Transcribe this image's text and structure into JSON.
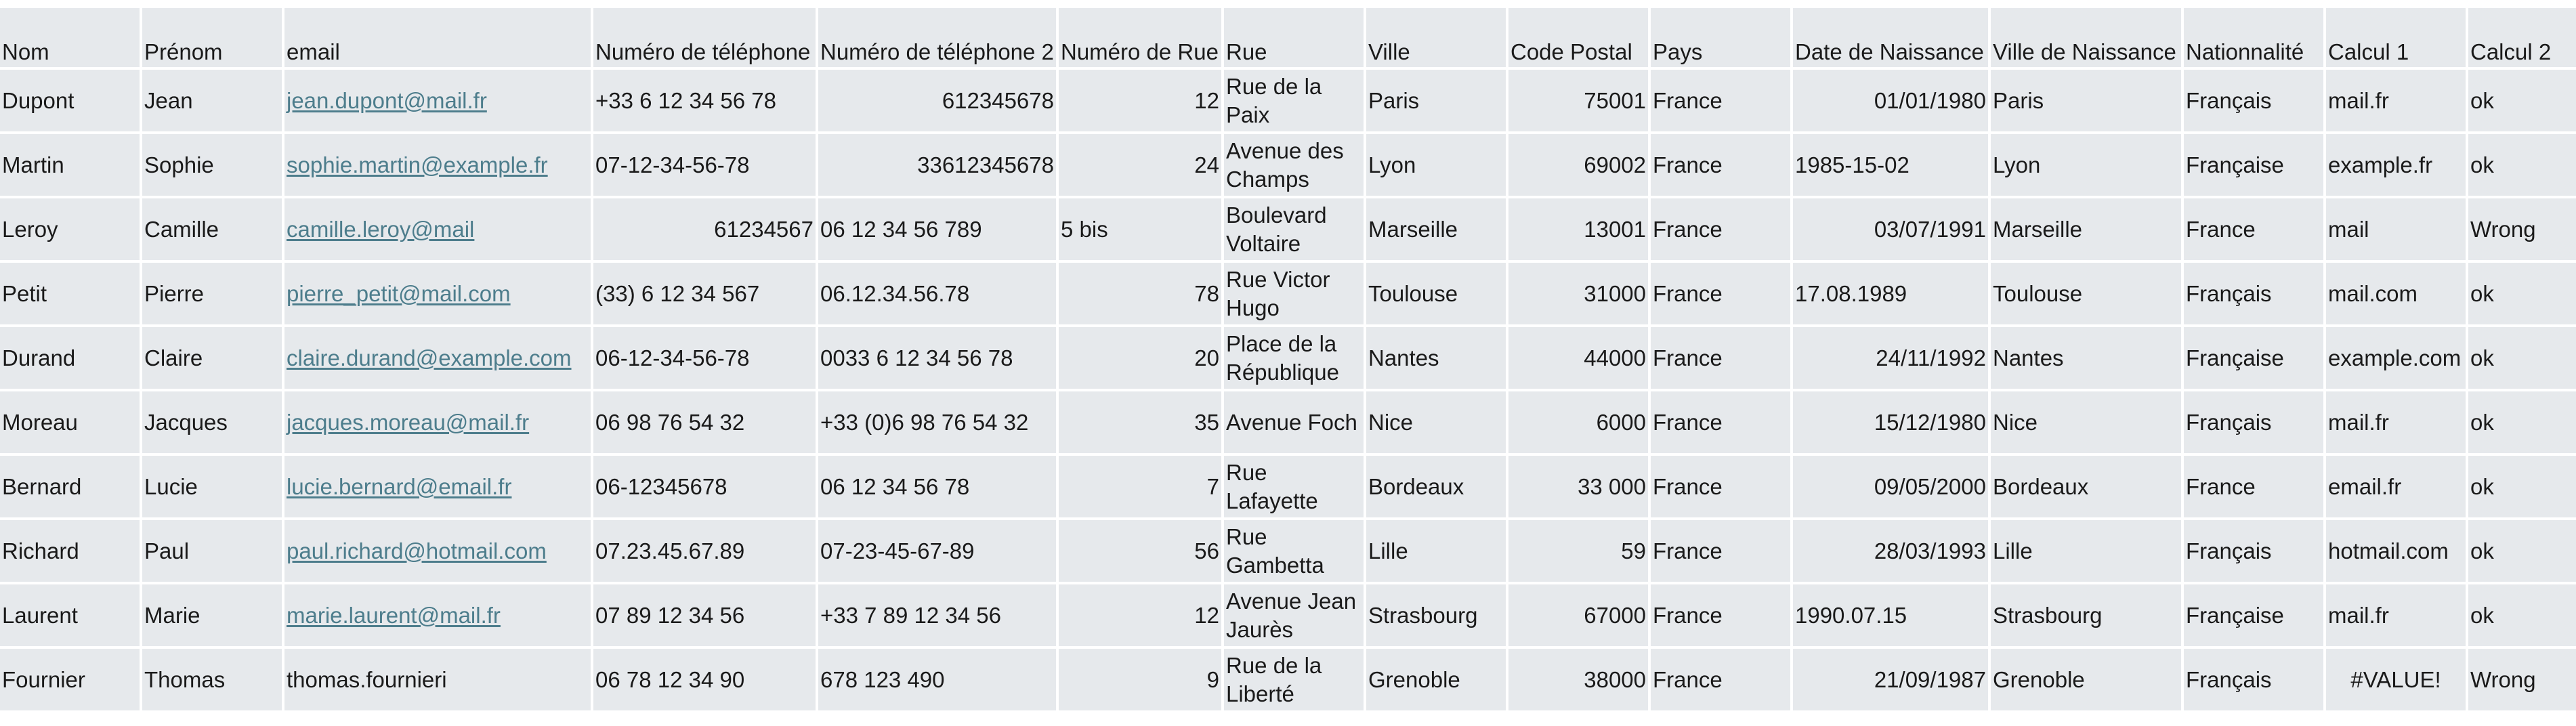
{
  "sheet": {
    "headers": [
      "Nom",
      "Prénom",
      "email",
      "Numéro de téléphone",
      "Numéro de téléphone 2",
      "Numéro de Rue",
      "Rue",
      "Ville",
      "Code Postal",
      "Pays",
      "Date de Naissance",
      "Ville de Naissance",
      "Nationnalité",
      "Calcul 1",
      "Calcul 2"
    ],
    "rows": [
      [
        "Dupont",
        "Jean",
        "jean.dupont@mail.fr",
        "+33 6 12 34 56 78",
        "612345678",
        "12",
        "Rue de la Paix",
        "Paris",
        "75001",
        "France",
        "01/01/1980",
        "Paris",
        "Français",
        "mail.fr",
        "ok"
      ],
      [
        "Martin",
        "Sophie",
        "sophie.martin@example.fr",
        "07-12-34-56-78",
        "33612345678",
        "24",
        "Avenue des Champs",
        "Lyon",
        "69002",
        "France",
        "1985-15-02",
        "Lyon",
        "Française",
        "example.fr",
        "ok"
      ],
      [
        "Leroy",
        "Camille",
        "camille.leroy@mail",
        "61234567",
        "06 12 34 56 789",
        "5 bis",
        "Boulevard Voltaire",
        "Marseille",
        "13001",
        "France",
        "03/07/1991",
        "Marseille",
        "France",
        "mail",
        "Wrong"
      ],
      [
        "Petit",
        "Pierre",
        "pierre_petit@mail.com",
        "(33) 6 12 34 567",
        "06.12.34.56.78",
        "78",
        "Rue Victor Hugo",
        "Toulouse",
        "31000",
        "France",
        "17.08.1989",
        "Toulouse",
        "Français",
        "mail.com",
        "ok"
      ],
      [
        "Durand",
        "Claire",
        "claire.durand@example.com",
        "06-12-34-56-78",
        "0033 6 12 34 56 78",
        "20",
        "Place de la République",
        "Nantes",
        "44000",
        "France",
        "24/11/1992",
        "Nantes",
        "Française",
        "example.com",
        "ok"
      ],
      [
        "Moreau",
        "Jacques",
        "jacques.moreau@mail.fr",
        "06 98 76 54 32",
        "+33 (0)6 98 76 54 32",
        "35",
        "Avenue Foch",
        "Nice",
        "6000",
        "France",
        "15/12/1980",
        "Nice",
        "Français",
        "mail.fr",
        "ok"
      ],
      [
        "Bernard",
        "Lucie",
        "lucie.bernard@email.fr",
        "06-12345678",
        "06 12 34 56 78",
        "7",
        "Rue Lafayette",
        "Bordeaux",
        "33 000",
        "France",
        "09/05/2000",
        "Bordeaux",
        "France",
        "email.fr",
        "ok"
      ],
      [
        "Richard",
        "Paul",
        "paul.richard@hotmail.com",
        "07.23.45.67.89",
        "07-23-45-67-89",
        "56",
        "Rue Gambetta",
        "Lille",
        "59",
        "France",
        "28/03/1993",
        "Lille",
        "Français",
        "hotmail.com",
        "ok"
      ],
      [
        "Laurent",
        "Marie",
        "marie.laurent@mail.fr",
        "07 89 12 34 56",
        "+33 7 89 12 34 56",
        "12",
        "Avenue Jean Jaurès",
        "Strasbourg",
        "67000",
        "France",
        "1990.07.15",
        "Strasbourg",
        "Française",
        "mail.fr",
        "ok"
      ],
      [
        "Fournier",
        "Thomas",
        "thomas.fournieri",
        "06 78 12 34 90",
        "678 123 490",
        "9",
        "Rue de la Liberté",
        "Grenoble",
        "38000",
        "France",
        "21/09/1987",
        "Grenoble",
        "Français",
        "#VALUE!",
        "Wrong"
      ]
    ],
    "colors": {
      "cell_background": "#e6e9ec",
      "grid_lines": "#ffffff",
      "link_text": "#4d7d8c",
      "text": "#1a1a1a"
    }
  }
}
